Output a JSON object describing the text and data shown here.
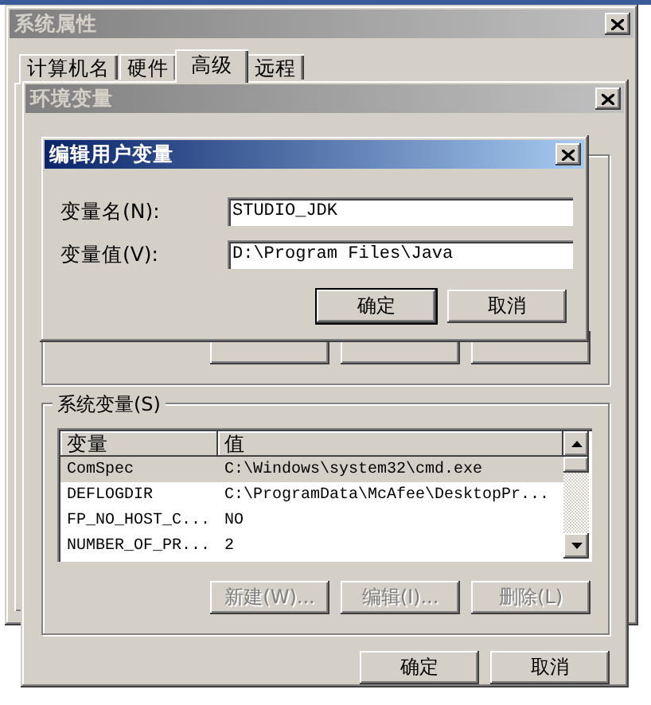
{
  "system_properties": {
    "title": "系统属性",
    "active": false,
    "tabs": [
      {
        "label": "计算机名",
        "selected": false
      },
      {
        "label": "硬件",
        "selected": false
      },
      {
        "label": "高级",
        "selected": true
      },
      {
        "label": "远程",
        "selected": false
      }
    ]
  },
  "environment_variables": {
    "title": "环境变量",
    "active": false,
    "system_variables": {
      "label": "系统变量(S)",
      "columns": [
        "变量",
        "值"
      ],
      "rows": [
        {
          "name": "ComSpec",
          "value": "C:\\Windows\\system32\\cmd.exe",
          "selected": true
        },
        {
          "name": "DEFLOGDIR",
          "value": "C:\\ProgramData\\McAfee\\DesktopPr...",
          "selected": false
        },
        {
          "name": "FP_NO_HOST_C...",
          "value": "NO",
          "selected": false
        },
        {
          "name": "NUMBER_OF_PR...",
          "value": "2",
          "selected": false
        }
      ],
      "buttons": [
        {
          "label": "新建(W)...",
          "disabled": true
        },
        {
          "label": "编辑(I)...",
          "disabled": true
        },
        {
          "label": "删除(L)",
          "disabled": true
        }
      ]
    },
    "buttons": [
      {
        "label": "确定"
      },
      {
        "label": "取消"
      }
    ]
  },
  "edit_user_variable": {
    "title": "编辑用户变量",
    "active": true,
    "fields": [
      {
        "label": "变量名(N):",
        "value": "STUDIO_JDK"
      },
      {
        "label": "变量值(V):",
        "value": "D:\\Program Files\\Java"
      }
    ],
    "buttons": [
      {
        "label": "确定",
        "default": true
      },
      {
        "label": "取消",
        "default": false
      }
    ]
  }
}
